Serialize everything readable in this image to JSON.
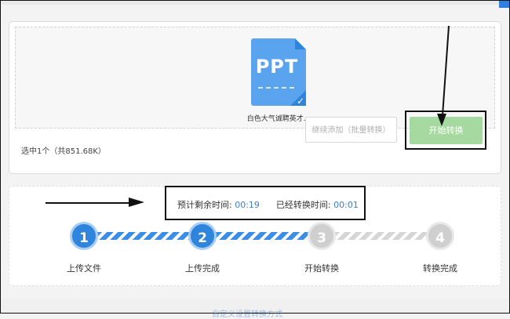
{
  "file": {
    "type_label": "PPT",
    "name": "白色大气诚聘英才..."
  },
  "upload": {
    "selected_info": "选中1个（共851.68K）",
    "continue_button": "继续添加（批量转换）",
    "start_button": "开始转换"
  },
  "progress": {
    "remaining_label": "预计剩余时间:",
    "remaining_value": "00:19",
    "elapsed_label": "已经转换时间:",
    "elapsed_value": "00:01",
    "steps": [
      {
        "number": "1",
        "label": "上传文件",
        "state": "done"
      },
      {
        "number": "2",
        "label": "上传完成",
        "state": "done"
      },
      {
        "number": "3",
        "label": "开始转换",
        "state": "pending"
      },
      {
        "number": "4",
        "label": "转换完成",
        "state": "pending"
      }
    ]
  },
  "footer": {
    "link_text": "自定义设置转换方式"
  },
  "colors": {
    "accent_blue": "#2f84dc",
    "start_button_green": "#a6d9a0",
    "pending_gray": "#cfcfcf"
  }
}
